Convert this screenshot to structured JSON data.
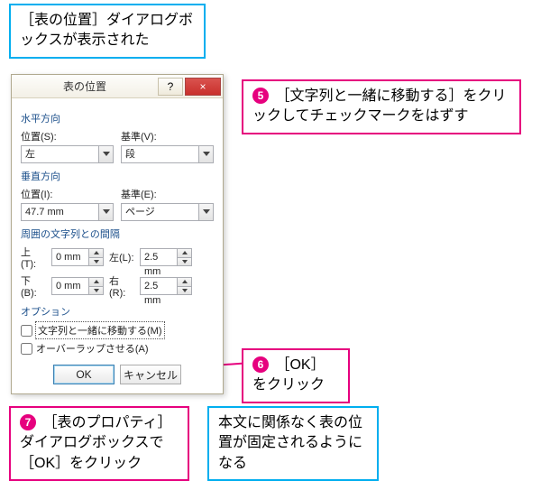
{
  "callouts": {
    "top": "［表の位置］ダイアログボックスが表示された",
    "step5": "［文字列と一緒に移動する］をクリックしてチェックマークをはずす",
    "step6": "［OK］をクリック",
    "step7": "［表のプロパティ］ダイアログボックスで［OK］をクリック",
    "bottom": "本文に関係なく表の位置が固定されるようになる",
    "num5": "5",
    "num6": "6",
    "num7": "7"
  },
  "dialog": {
    "title": "表の位置",
    "help": "?",
    "close": "×",
    "horiz": {
      "group": "水平方向",
      "pos_label": "位置(S):",
      "pos_value": "左",
      "base_label": "基準(V):",
      "base_value": "段"
    },
    "vert": {
      "group": "垂直方向",
      "pos_label": "位置(I):",
      "pos_value": "47.7 mm",
      "base_label": "基準(E):",
      "base_value": "ページ"
    },
    "margins": {
      "group": "周囲の文字列との間隔",
      "top_label": "上(T):",
      "top_value": "0 mm",
      "left_label": "左(L):",
      "left_value": "2.5 mm",
      "bottom_label": "下(B):",
      "bottom_value": "0 mm",
      "right_label": "右(R):",
      "right_value": "2.5 mm"
    },
    "options": {
      "group": "オプション",
      "move_with_text": "文字列と一緒に移動する(M)",
      "overlap": "オーバーラップさせる(A)"
    },
    "buttons": {
      "ok": "OK",
      "cancel": "キャンセル"
    }
  }
}
